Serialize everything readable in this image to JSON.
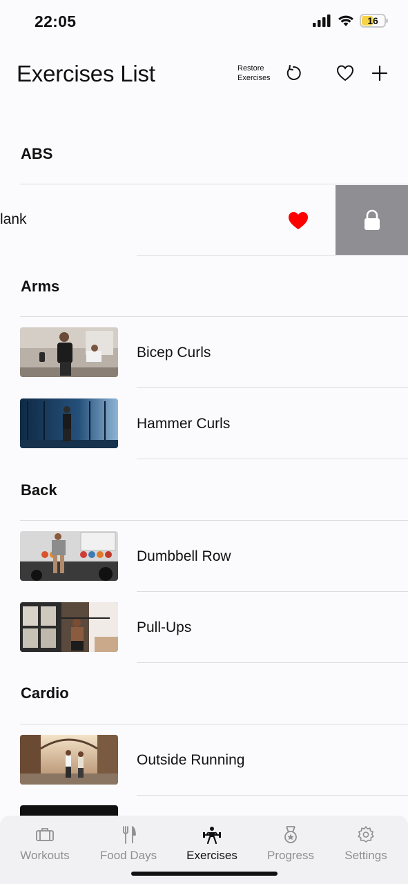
{
  "status": {
    "time": "22:05",
    "battery": "16"
  },
  "nav": {
    "title": "Exercises List",
    "restore_label_line1": "Restore",
    "restore_label_line2": "Exercises"
  },
  "sections": [
    {
      "name": "ABS",
      "items": [
        {
          "label": "lank",
          "favorite": true,
          "locked": true,
          "swiped": true
        }
      ]
    },
    {
      "name": "Arms",
      "items": [
        {
          "label": "Bicep Curls"
        },
        {
          "label": "Hammer Curls"
        }
      ]
    },
    {
      "name": "Back",
      "items": [
        {
          "label": "Dumbbell Row"
        },
        {
          "label": "Pull-Ups"
        }
      ]
    },
    {
      "name": "Cardio",
      "items": [
        {
          "label": "Outside Running"
        }
      ]
    }
  ],
  "tabs": [
    {
      "label": "Workouts",
      "icon": "dumbbell-icon"
    },
    {
      "label": "Food Days",
      "icon": "fork-knife-icon"
    },
    {
      "label": "Exercises",
      "icon": "weightlifter-icon",
      "active": true
    },
    {
      "label": "Progress",
      "icon": "medal-icon"
    },
    {
      "label": "Settings",
      "icon": "gear-icon"
    }
  ],
  "colors": {
    "favorite": "#ff0000",
    "swipe_action_bg": "#8e8e93",
    "accent_text": "#111111",
    "inactive_tab": "#8e8e93"
  }
}
